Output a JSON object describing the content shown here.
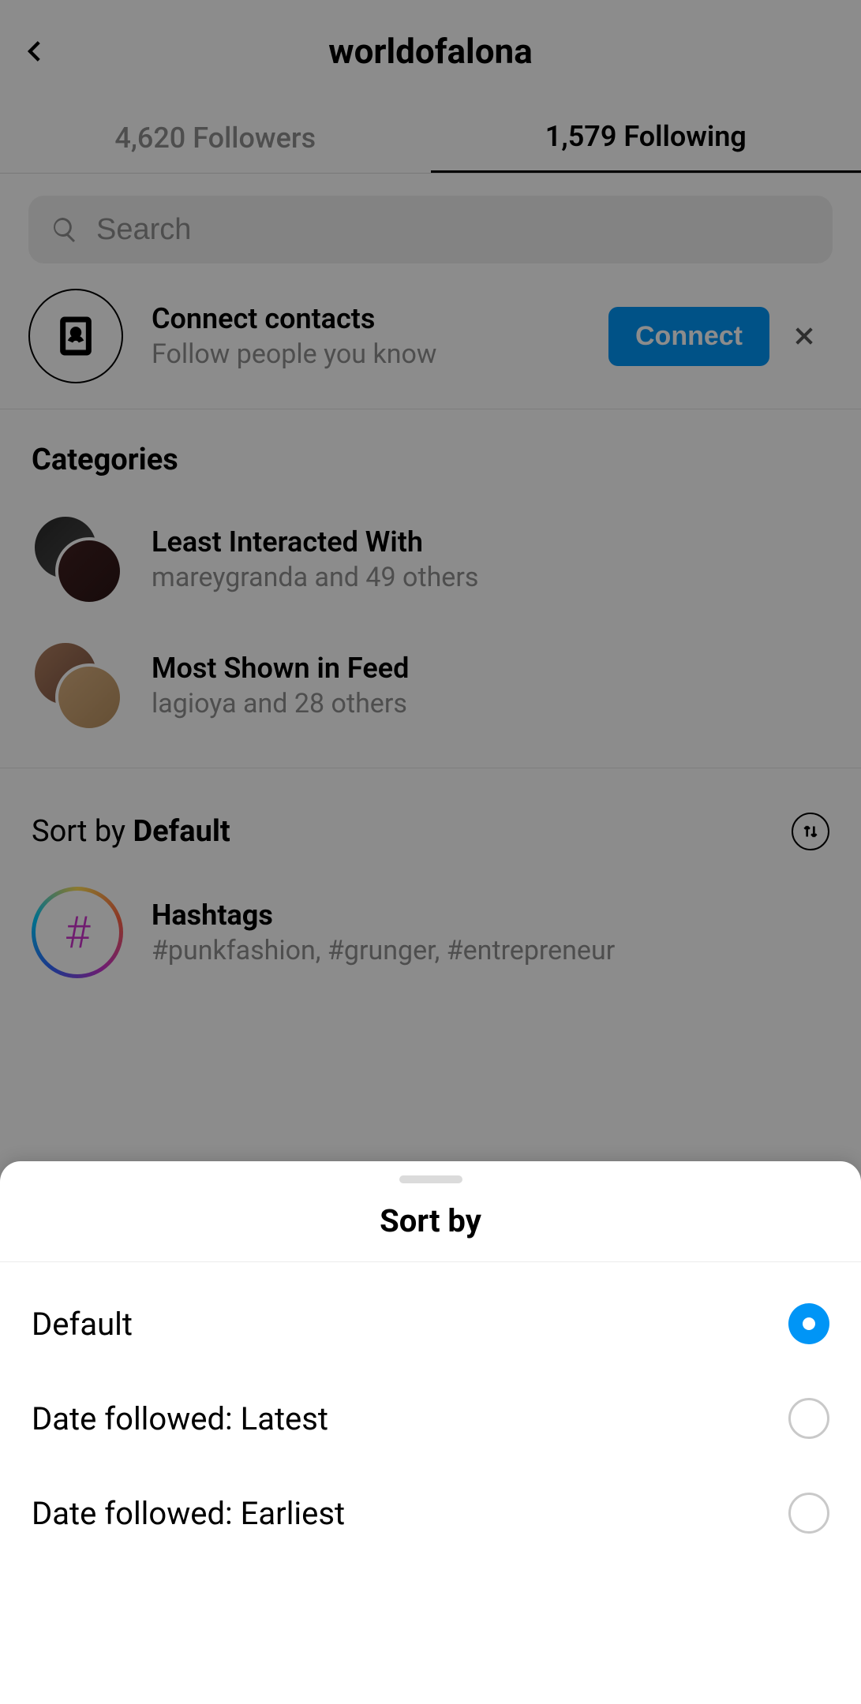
{
  "header": {
    "title": "worldofalona"
  },
  "tabs": {
    "followers_label": "4,620 Followers",
    "following_label": "1,579 Following"
  },
  "search": {
    "placeholder": "Search"
  },
  "connect": {
    "title": "Connect contacts",
    "subtitle": "Follow people you know",
    "button": "Connect"
  },
  "categories": {
    "heading": "Categories",
    "items": [
      {
        "title": "Least Interacted With",
        "subtitle": "mareygranda and 49 others"
      },
      {
        "title": "Most Shown in Feed",
        "subtitle": "lagioya and 28 others"
      }
    ]
  },
  "sort": {
    "prefix": "Sort by ",
    "value": "Default"
  },
  "hashtags": {
    "title": "Hashtags",
    "subtitle": "#punkfashion, #grunger, #entrepreneur"
  },
  "sheet": {
    "title": "Sort by",
    "options": [
      {
        "label": "Default",
        "selected": true
      },
      {
        "label": "Date followed: Latest",
        "selected": false
      },
      {
        "label": "Date followed: Earliest",
        "selected": false
      }
    ]
  }
}
